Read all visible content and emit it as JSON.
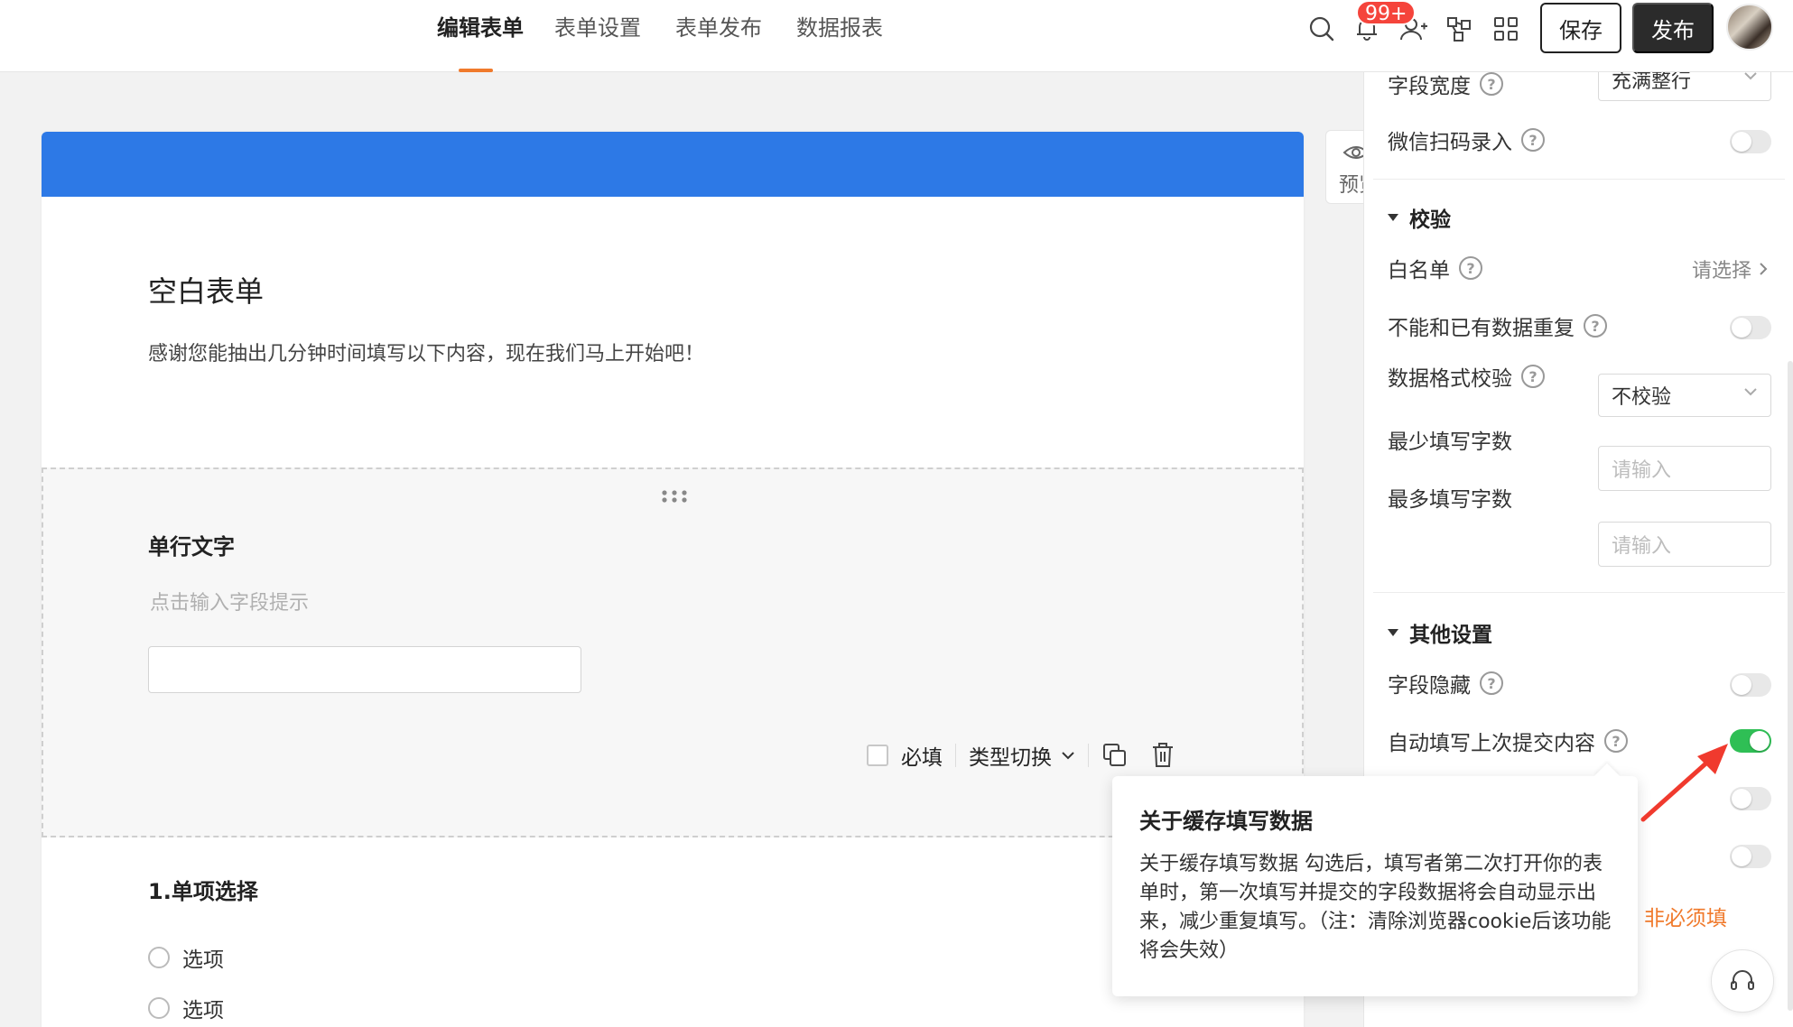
{
  "nav": {
    "tabs": [
      "编辑表单",
      "表单设置",
      "表单发布",
      "数据报表"
    ],
    "active_index": 0,
    "notification_badge": "99+",
    "save_label": "保存",
    "publish_label": "发布",
    "icons": [
      "search-icon",
      "bell-icon",
      "add-user-icon",
      "flowchart-icon",
      "grid-apps-icon"
    ]
  },
  "form": {
    "banner_color": "#2d79e6",
    "title": "空白表单",
    "description": "感谢您能抽出几分钟时间填写以下内容，现在我们马上开始吧！",
    "field": {
      "label": "单行文字",
      "hint": "点击输入字段提示",
      "required_label": "必填",
      "type_switch_label": "类型切换"
    },
    "question2": {
      "label": "1.单项选择",
      "options": [
        "选项",
        "选项"
      ]
    }
  },
  "preview_tab": "预览",
  "panel": {
    "field_width": {
      "label": "字段宽度",
      "value": "充满整行"
    },
    "wechat_scan": {
      "label": "微信扫码录入",
      "enabled": false
    },
    "validation_section": "校验",
    "whitelist": {
      "label": "白名单",
      "value": "请选择"
    },
    "no_duplicate": {
      "label": "不能和已有数据重复",
      "enabled": false
    },
    "data_format": {
      "label": "数据格式校验",
      "value": "不校验"
    },
    "min_chars": {
      "label": "最少填写字数",
      "placeholder": "请输入"
    },
    "max_chars": {
      "label": "最多填写字数",
      "placeholder": "请输入"
    },
    "other_section": "其他设置",
    "field_hidden": {
      "label": "字段隐藏",
      "enabled": false
    },
    "autofill_last": {
      "label": "自动填写上次提交内容",
      "enabled": true
    },
    "hidden_toggle_1": {
      "enabled": false
    },
    "hidden_toggle_2": {
      "enabled": false
    },
    "not_required_text": "非必须填"
  },
  "popover": {
    "title": "关于缓存填写数据",
    "body": "关于缓存填写数据 勾选后，填写者第二次打开你的表单时，第一次填写并提交的字段数据将会自动显示出来，减少重复填写。（注：清除浏览器cookie后该功能将会失效）"
  },
  "colors": {
    "accent": "#f07a2c",
    "toggle_on": "#2fbf55",
    "arrow": "#f03a2e"
  }
}
